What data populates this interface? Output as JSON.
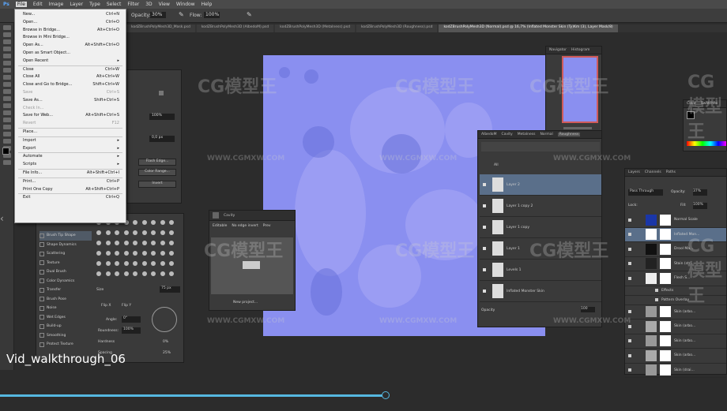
{
  "menubar": {
    "logo": "Ps",
    "items": [
      "File",
      "Edit",
      "Image",
      "Layer",
      "Type",
      "Select",
      "Filter",
      "3D",
      "View",
      "Window",
      "Help"
    ]
  },
  "options_bar": {
    "opacity_label": "Opacity:",
    "opacity_value": "30%",
    "flow_label": "Flow:",
    "flow_value": "100%"
  },
  "tabs": [
    {
      "label": "kodZBrushPolyMesh3D_Mask.psd",
      "active": false
    },
    {
      "label": "kodZBrushPolyMesh3D (AlbedoM).psd",
      "active": false
    },
    {
      "label": "kodZBrushPolyMesh3D (Metalness).psd",
      "active": false
    },
    {
      "label": "kodZBrushPolyMesh3D (Roughness).psd",
      "active": false
    },
    {
      "label": "kodZBrushPolyMesh3D (Normal).psd @ 16,7% (Inflated Monster Skin (Ty)Km (3), Layer Mask/8)",
      "active": true
    }
  ],
  "file_menu": [
    {
      "label": "New...",
      "shortcut": "Ctrl+N"
    },
    {
      "label": "Open...",
      "shortcut": "Ctrl+O"
    },
    {
      "label": "Browse in Bridge...",
      "shortcut": "Alt+Ctrl+O"
    },
    {
      "label": "Browse in Mini Bridge...",
      "shortcut": ""
    },
    {
      "label": "Open As...",
      "shortcut": "Alt+Shift+Ctrl+O"
    },
    {
      "label": "Open as Smart Object...",
      "shortcut": ""
    },
    {
      "label": "Open Recent",
      "shortcut": "▸"
    },
    {
      "sep": true
    },
    {
      "label": "Close",
      "shortcut": "Ctrl+W"
    },
    {
      "label": "Close All",
      "shortcut": "Alt+Ctrl+W"
    },
    {
      "label": "Close and Go to Bridge...",
      "shortcut": "Shift+Ctrl+W"
    },
    {
      "label": "Save",
      "shortcut": "Ctrl+S",
      "disabled": true
    },
    {
      "label": "Save As...",
      "shortcut": "Shift+Ctrl+S"
    },
    {
      "label": "Check In...",
      "shortcut": "",
      "disabled": true
    },
    {
      "label": "Save for Web...",
      "shortcut": "Alt+Shift+Ctrl+S"
    },
    {
      "label": "Revert",
      "shortcut": "F12",
      "disabled": true
    },
    {
      "sep": true
    },
    {
      "label": "Place...",
      "shortcut": ""
    },
    {
      "sep": true
    },
    {
      "label": "Import",
      "shortcut": "▸"
    },
    {
      "label": "Export",
      "shortcut": "▸"
    },
    {
      "sep": true
    },
    {
      "label": "Automate",
      "shortcut": "▸"
    },
    {
      "label": "Scripts",
      "shortcut": "▸"
    },
    {
      "sep": true
    },
    {
      "label": "File Info...",
      "shortcut": "Alt+Shift+Ctrl+I"
    },
    {
      "sep": true
    },
    {
      "label": "Print...",
      "shortcut": "Ctrl+P"
    },
    {
      "label": "Print One Copy",
      "shortcut": "Alt+Shift+Ctrl+P"
    },
    {
      "sep": true
    },
    {
      "label": "Exit",
      "shortcut": "Ctrl+Q"
    }
  ],
  "left_panel": {
    "field_1": "100%",
    "field_2": "0,0 px",
    "btn_1": "Flash Edge...",
    "btn_2": "Color Range...",
    "btn_3": "Invert"
  },
  "brush_panel": {
    "items": [
      "Brush Tip Shape",
      "Shape Dynamics",
      "Scattering",
      "Texture",
      "Dual Brush",
      "Color Dynamics",
      "Transfer",
      "Brush Pose",
      "Noise",
      "Wet Edges",
      "Build-up",
      "Smoothing",
      "Protect Texture"
    ],
    "size_label": "Size",
    "size_value": "75 px",
    "flip_x": "Flip X",
    "flip_y": "Flip Y",
    "angle_label": "Angle:",
    "angle_value": "0°",
    "round_label": "Roundness:",
    "round_value": "100%",
    "hard_label": "Hardness",
    "hard_value": "0%",
    "spacing_label": "Spacing",
    "spacing_value": "25%"
  },
  "cavity_panel": {
    "title": "Cavity",
    "opt_1": "Editable",
    "opt_2": "No edge invert",
    "opt_3": "Prev",
    "button": "New project..."
  },
  "navigator": {
    "tab_1": "Navigator",
    "tab_2": "Histogram"
  },
  "color_panel": {
    "tab_1": "Color",
    "tab_2": "Swatches"
  },
  "channels_panel": {
    "tabs": [
      "AlbedoM",
      "Cavity",
      "Metalness",
      "Normal",
      "Roughness"
    ],
    "filter": "All",
    "layers": [
      "Layer 2",
      "Layer 1 copy 2",
      "Layer 1 copy",
      "Layer 1",
      "Levels 1",
      "Inflated Monster Skin"
    ],
    "opacity_label": "Opacity",
    "opacity_value": "100"
  },
  "layers_panel": {
    "tabs": [
      "Layers",
      "Channels",
      "Paths"
    ],
    "blend": "Pass Through",
    "opacity_label": "Opacity:",
    "opacity_value": "37%",
    "fill_label": "Fill:",
    "fill_value": "100%",
    "lock_label": "Lock:",
    "layers": [
      "Normal Scale",
      "Inflated Mon...",
      "Drool Ma...",
      "Stain (str...",
      "Flesh S...",
      "Effects",
      "Pattern Overlay",
      "Skin (arbo...",
      "Skin (arbo...",
      "Skin (arbo...",
      "Skin (arbo...",
      "Skin (drai..."
    ]
  },
  "video": {
    "caption": "Vid_walkthrough_06",
    "progress": 0.53
  },
  "watermark": {
    "logo": "CG模型王",
    "url": "WWW.CGMXW.COM"
  },
  "colors": {
    "normal_map": "#8a8ff0",
    "accent": "#56b8e0",
    "menu_bg": "#f0f0f0"
  }
}
